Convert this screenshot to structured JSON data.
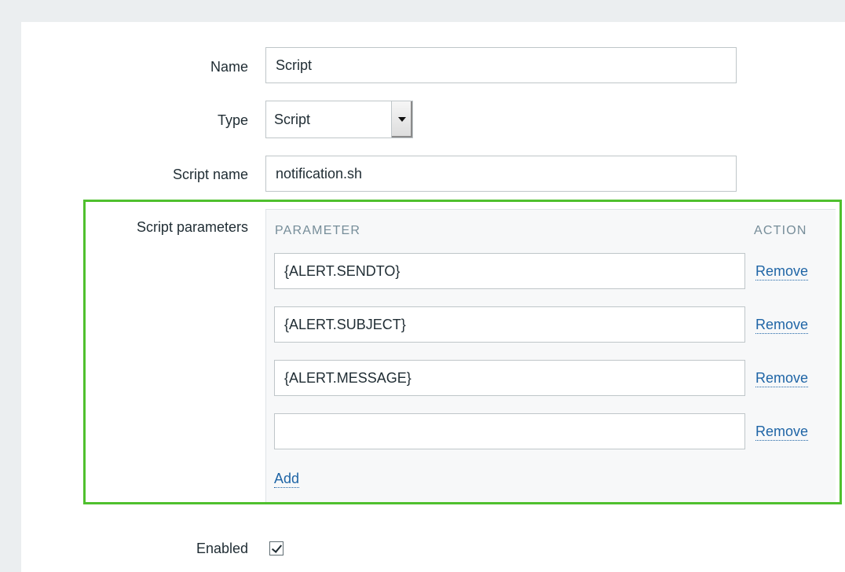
{
  "form": {
    "name": {
      "label": "Name",
      "value": "Script"
    },
    "type": {
      "label": "Type",
      "value": "Script"
    },
    "script_name": {
      "label": "Script name",
      "value": "notification.sh"
    },
    "script_parameters": {
      "label": "Script parameters",
      "column_parameter": "PARAMETER",
      "column_action": "ACTION",
      "rows": [
        {
          "value": "{ALERT.SENDTO}",
          "action": "Remove"
        },
        {
          "value": "{ALERT.SUBJECT}",
          "action": "Remove"
        },
        {
          "value": "{ALERT.MESSAGE}",
          "action": "Remove"
        },
        {
          "value": "",
          "action": "Remove"
        }
      ],
      "add_label": "Add"
    },
    "enabled": {
      "label": "Enabled",
      "checked": true
    }
  },
  "colors": {
    "highlight": "#4fc02e",
    "link": "#1f65a6",
    "background": "#ebeef0"
  }
}
